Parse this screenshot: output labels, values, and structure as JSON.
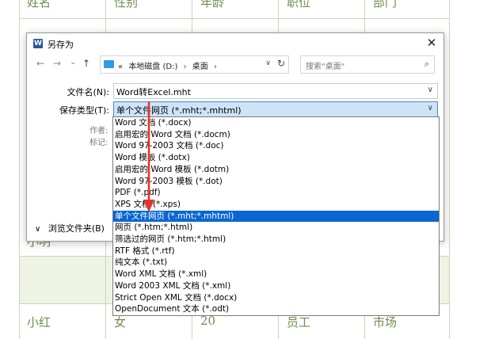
{
  "background": {
    "header_cells": [
      "姓名",
      "性别",
      "年龄",
      "职位",
      "部门"
    ],
    "row_xiaoming": "小明",
    "row_xiaohong": [
      "小红",
      "女",
      "20",
      "员工",
      "市场"
    ]
  },
  "dialog": {
    "app_icon": "W",
    "title": "另存为",
    "close_glyph": "✕",
    "nav": {
      "back": "←",
      "forward": "→",
      "up_menu": "⌄",
      "up": "↑"
    },
    "breadcrumb": {
      "overflow": "«",
      "drive": "本地磁盘 (D:)",
      "folder": "桌面",
      "sep": "›"
    },
    "search_placeholder": "搜索\"桌面\"",
    "filename_label": "文件名(N):",
    "filename_value": "Word转Excel.mht",
    "savetype_label": "保存类型(T):",
    "savetype_value": "单个文件网页 (*.mht;*.mhtml)",
    "author_label": "作者:",
    "tags_label": "标记:",
    "browse_folders": "浏览文件夹(B)"
  },
  "dropdown": {
    "options": [
      "Word 文档 (*.docx)",
      "启用宏的 Word 文档 (*.docm)",
      "Word 97-2003 文档 (*.doc)",
      "Word 模板 (*.dotx)",
      "启用宏的 Word 模板 (*.dotm)",
      "Word 97-2003 模板 (*.dot)",
      "PDF (*.pdf)",
      "XPS 文档 (*.xps)",
      "单个文件网页 (*.mht;*.mhtml)",
      "网页 (*.htm;*.html)",
      "筛选过的网页 (*.htm;*.html)",
      "RTF 格式 (*.rtf)",
      "纯文本 (*.txt)",
      "Word XML 文档 (*.xml)",
      "Word 2003 XML 文档 (*.xml)",
      "Strict Open XML 文档 (*.docx)",
      "OpenDocument 文本 (*.odt)"
    ],
    "selected_index": 8
  },
  "colors": {
    "accent": "#0a66d1",
    "annotation": "#e8312a",
    "table_text": "#6e8d4e"
  }
}
